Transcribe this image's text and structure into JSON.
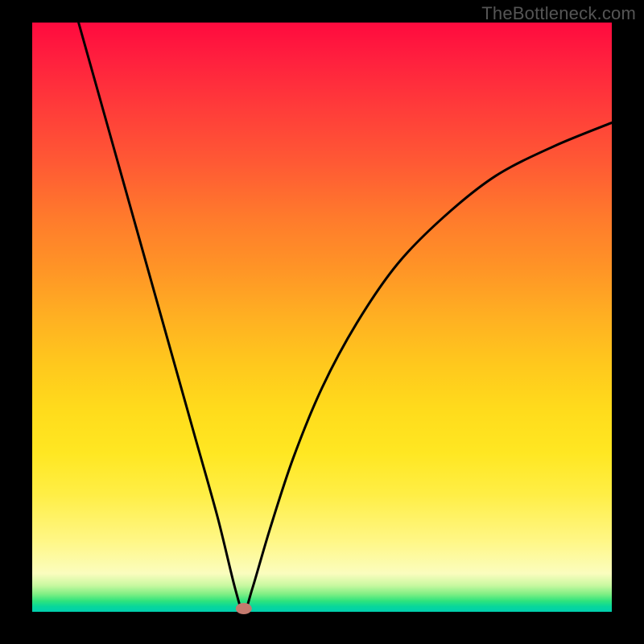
{
  "watermark": "TheBottleneck.com",
  "chart_data": {
    "type": "line",
    "title": "",
    "xlabel": "",
    "ylabel": "",
    "xlim": [
      0,
      100
    ],
    "ylim": [
      0,
      100
    ],
    "grid": false,
    "legend": false,
    "curve": {
      "name": "bottleneck-curve",
      "points": [
        {
          "x": 8,
          "y": 100
        },
        {
          "x": 12,
          "y": 86
        },
        {
          "x": 16,
          "y": 72
        },
        {
          "x": 20,
          "y": 58
        },
        {
          "x": 24,
          "y": 44
        },
        {
          "x": 28,
          "y": 30
        },
        {
          "x": 32,
          "y": 16
        },
        {
          "x": 35,
          "y": 4
        },
        {
          "x": 36.5,
          "y": 0
        },
        {
          "x": 38,
          "y": 4
        },
        {
          "x": 41,
          "y": 14
        },
        {
          "x": 45,
          "y": 26
        },
        {
          "x": 50,
          "y": 38
        },
        {
          "x": 56,
          "y": 49
        },
        {
          "x": 63,
          "y": 59
        },
        {
          "x": 71,
          "y": 67
        },
        {
          "x": 80,
          "y": 74
        },
        {
          "x": 90,
          "y": 79
        },
        {
          "x": 100,
          "y": 83
        }
      ]
    },
    "marker": {
      "x": 36.5,
      "y": 0,
      "color": "#c47a6e"
    }
  }
}
